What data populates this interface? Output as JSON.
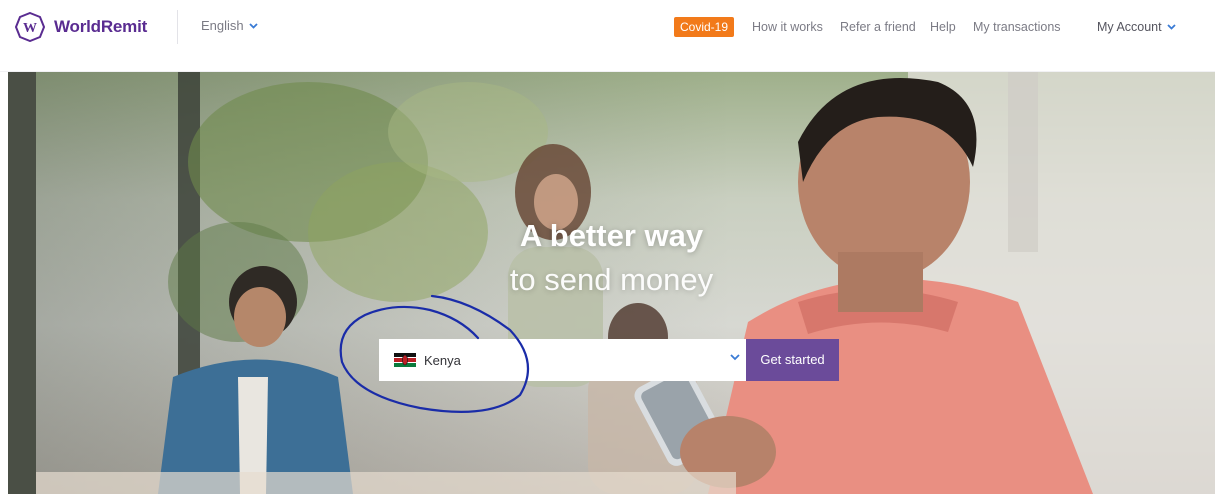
{
  "brand": {
    "logo_letter": "W",
    "name": "WorldRemit",
    "color": "#5a2c91"
  },
  "nav": {
    "language": "English",
    "covid_badge": "Covid-19",
    "covid_color": "#f27a1a",
    "links": [
      "How it works",
      "Refer a friend",
      "Help",
      "My transactions"
    ],
    "account": "My Account"
  },
  "hero": {
    "title": "A better way",
    "subtitle": "to send money",
    "country_select": {
      "selected": "Kenya",
      "flag": "kenya-flag-icon"
    },
    "cta_label": "Get started",
    "cta_color": "#6b4b9a"
  }
}
